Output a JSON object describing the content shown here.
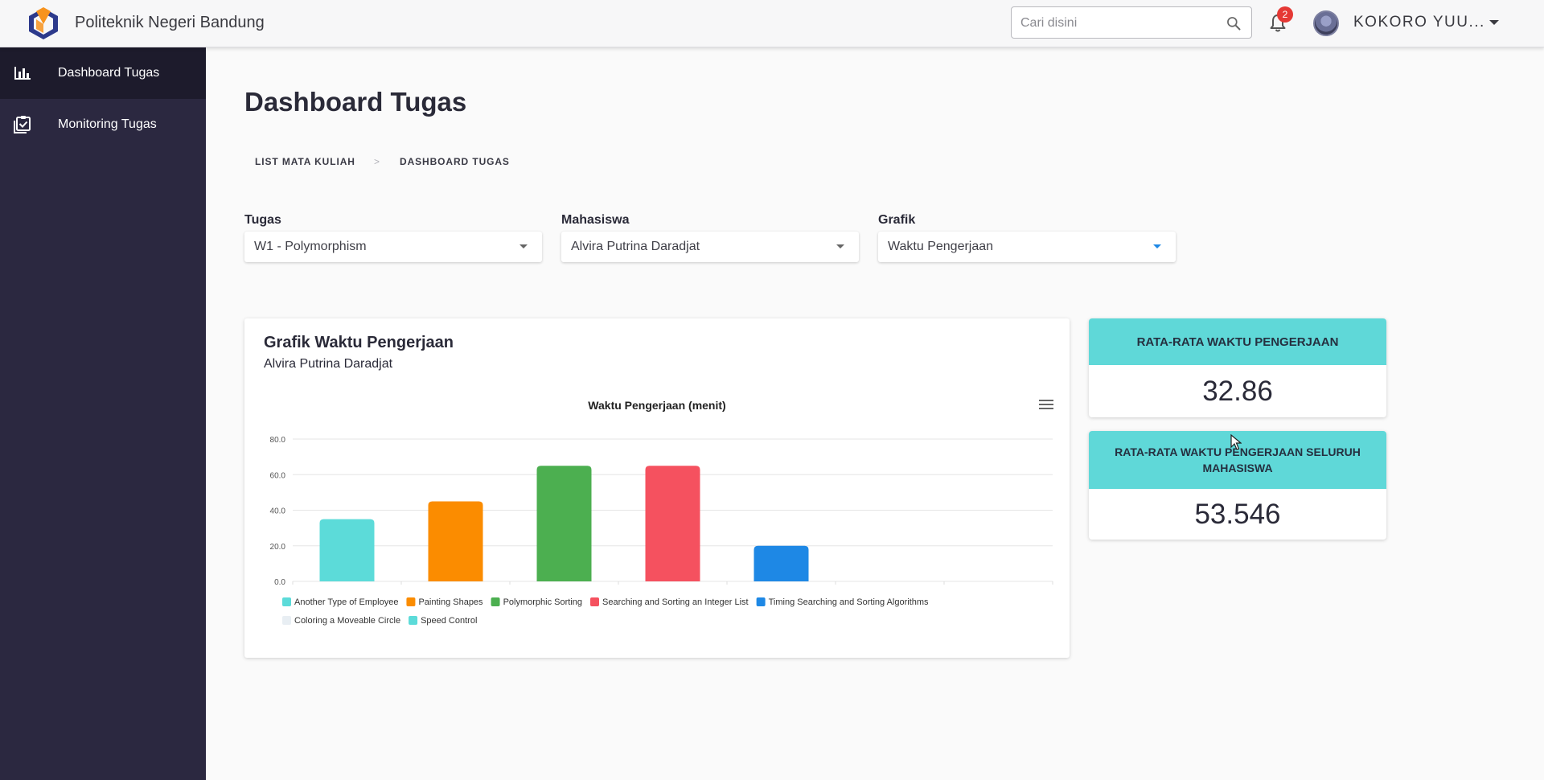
{
  "app": {
    "brand": "Politeknik Negeri Bandung",
    "search_placeholder": "Cari disini",
    "notification_count": "2",
    "username": "KOKORO YUU..."
  },
  "sidebar": {
    "items": [
      {
        "label": "Dashboard Tugas",
        "icon": "bar-chart-icon",
        "active": true
      },
      {
        "label": "Monitoring Tugas",
        "icon": "clipboard-check-icon",
        "active": false
      }
    ]
  },
  "main": {
    "title": "Dashboard Tugas",
    "breadcrumb": {
      "items": [
        "LIST MATA KULIAH",
        "DASHBOARD TUGAS"
      ],
      "separator": ">"
    },
    "filters": [
      {
        "label": "Tugas",
        "value": "W1 - Polymorphism"
      },
      {
        "label": "Mahasiswa",
        "value": "Alvira Putrina Daradjat"
      },
      {
        "label": "Grafik",
        "value": "Waktu Pengerjaan"
      }
    ],
    "chart_card": {
      "title": "Grafik Waktu Pengerjaan",
      "subtitle": "Alvira Putrina Daradjat"
    },
    "stats": [
      {
        "heading": "RATA-RATA WAKTU PENGERJAAN",
        "value": "32.86"
      },
      {
        "heading": "RATA-RATA WAKTU PENGERJAAN SELURUH MAHASISWA",
        "value": "53.546"
      }
    ]
  },
  "colors": {
    "sidebar_bg": "#2b2840",
    "sidebar_active": "#1d1b2c",
    "stat_header": "#5fd8d8",
    "badge": "#e53935"
  },
  "chart_data": {
    "type": "bar",
    "title": "Waktu Pengerjaan (menit)",
    "xlabel": "",
    "ylabel": "",
    "ylim": [
      0,
      80
    ],
    "yticks": [
      "0.0",
      "20.0",
      "40.0",
      "60.0",
      "80.0"
    ],
    "grid": true,
    "legend_position": "bottom",
    "categories": [
      "Another Type of Employee",
      "Painting Shapes",
      "Polymorphic Sorting",
      "Searching and Sorting an Integer List",
      "Timing Searching and Sorting Algorithms",
      "Coloring a Moveable Circle",
      "Speed Control"
    ],
    "values": [
      35,
      45,
      65,
      65,
      20,
      0,
      0
    ],
    "colors": [
      "#5cdbd9",
      "#fb8c00",
      "#4caf50",
      "#f5515f",
      "#1e88e5",
      "#e8eef3",
      "#5cdbd9"
    ]
  }
}
